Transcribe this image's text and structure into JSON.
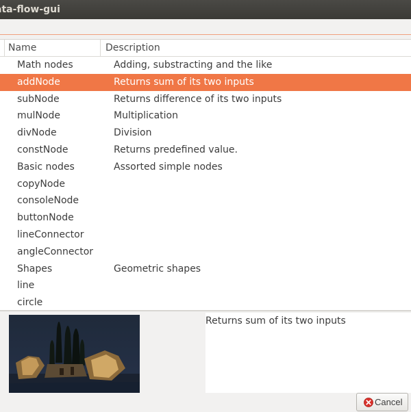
{
  "window": {
    "title": "ata-flow-gui"
  },
  "columns": {
    "name": "Name",
    "description": "Description"
  },
  "rows": [
    {
      "name": "Math nodes",
      "description": "Adding, substracting and the like",
      "selected": false
    },
    {
      "name": "addNode",
      "description": "Returns sum of its two inputs",
      "selected": true
    },
    {
      "name": "subNode",
      "description": "Returns difference of its two inputs",
      "selected": false
    },
    {
      "name": "mulNode",
      "description": "Multiplication",
      "selected": false
    },
    {
      "name": "divNode",
      "description": "Division",
      "selected": false
    },
    {
      "name": "constNode",
      "description": "Returns predefined value.",
      "selected": false
    },
    {
      "name": "Basic nodes",
      "description": "Assorted simple nodes",
      "selected": false
    },
    {
      "name": "copyNode",
      "description": "",
      "selected": false
    },
    {
      "name": "consoleNode",
      "description": "",
      "selected": false
    },
    {
      "name": "buttonNode",
      "description": "",
      "selected": false
    },
    {
      "name": "lineConnector",
      "description": "",
      "selected": false
    },
    {
      "name": "angleConnector",
      "description": "",
      "selected": false
    },
    {
      "name": "Shapes",
      "description": "Geometric shapes",
      "selected": false
    },
    {
      "name": "line",
      "description": "",
      "selected": false
    },
    {
      "name": "circle",
      "description": "",
      "selected": false
    }
  ],
  "details": {
    "description": "Returns sum of its two inputs"
  },
  "actions": {
    "cancel_label": "Cancel",
    "cancel_icon": "cancel-icon"
  },
  "colors": {
    "selection": "#f07746",
    "titlebar": "#3b3a36"
  }
}
